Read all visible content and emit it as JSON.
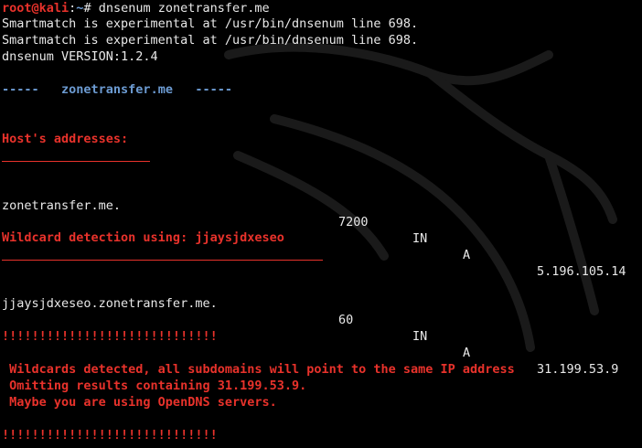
{
  "prompt": {
    "user_host": "root@kali",
    "separator": ":",
    "path": "~",
    "symbol": "#",
    "command": "dnsenum zonetransfer.me"
  },
  "warnings": [
    "Smartmatch is experimental at /usr/bin/dnsenum line 698.",
    "Smartmatch is experimental at /usr/bin/dnsenum line 698."
  ],
  "version": "dnsenum VERSION:1.2.4",
  "banner": {
    "left_dashes": "-----",
    "domain": "zonetransfer.me",
    "right_dashes": "-----"
  },
  "host_addresses": {
    "heading": "Host's addresses:",
    "rows": [
      {
        "name": "zonetransfer.me.",
        "ttl": "7200",
        "class": "IN",
        "type": "A",
        "address": "5.196.105.14"
      }
    ]
  },
  "wildcard": {
    "heading": "Wildcard detection using: jjaysjdxeseo",
    "rows": [
      {
        "name": "jjaysjdxeseo.zonetransfer.me.",
        "ttl": "60",
        "class": "IN",
        "type": "A",
        "address": "31.199.53.9"
      }
    ]
  },
  "alert": {
    "bang_line": "!!!!!!!!!!!!!!!!!!!!!!!!!!!!!",
    "messages": [
      " Wildcards detected, all subdomains will point to the same IP address",
      " Omitting results containing 31.199.53.9.",
      " Maybe you are using OpenDNS servers."
    ],
    "bang_line_bottom": "!!!!!!!!!!!!!!!!!!!!!!!!!!!!!"
  },
  "colors": {
    "background": "#000000",
    "text": "#e8e8e8",
    "accent_red": "#e8322b",
    "accent_blue": "#6c9bd2"
  }
}
